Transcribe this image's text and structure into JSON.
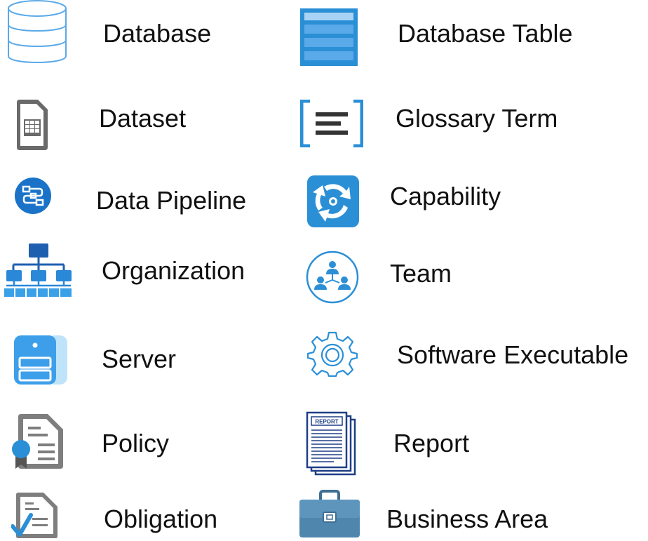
{
  "legend": {
    "left": [
      {
        "label": "Database",
        "icon": "database-icon"
      },
      {
        "label": "Dataset",
        "icon": "dataset-icon"
      },
      {
        "label": "Data Pipeline",
        "icon": "data-pipeline-icon"
      },
      {
        "label": "Organization",
        "icon": "organization-icon"
      },
      {
        "label": "Server",
        "icon": "server-icon"
      },
      {
        "label": "Policy",
        "icon": "policy-icon"
      },
      {
        "label": "Obligation",
        "icon": "obligation-icon"
      }
    ],
    "right": [
      {
        "label": "Database Table",
        "icon": "database-table-icon"
      },
      {
        "label": "Glossary Term",
        "icon": "glossary-term-icon"
      },
      {
        "label": "Capability",
        "icon": "capability-icon"
      },
      {
        "label": "Team",
        "icon": "team-icon"
      },
      {
        "label": "Software Executable",
        "icon": "software-executable-icon"
      },
      {
        "label": "Report",
        "icon": "report-icon",
        "icon_text": "REPORT"
      },
      {
        "label": "Business Area",
        "icon": "business-area-icon"
      }
    ]
  },
  "colors": {
    "blue": "#2b8fd6",
    "light_blue": "#5aa9e8",
    "grey": "#6e6e6e",
    "navy": "#1f3f86",
    "text": "#111111"
  }
}
